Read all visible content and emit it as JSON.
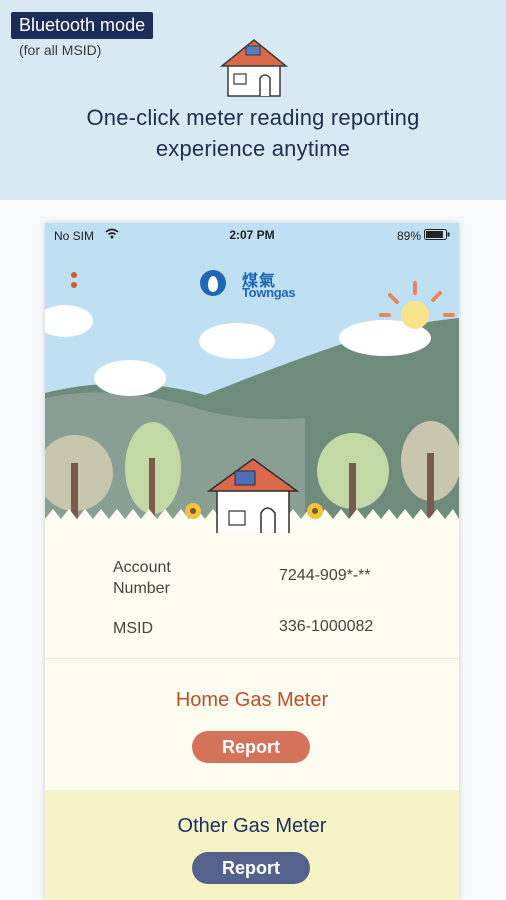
{
  "promo": {
    "badge": "Bluetooth mode",
    "note": "(for all MSID)",
    "headline_line1": "One-click meter reading reporting",
    "headline_line2": "experience anytime"
  },
  "status_bar": {
    "carrier": "No SIM",
    "time": "2:07 PM",
    "battery": "89%",
    "battery_level": 0.89
  },
  "logo": {
    "chinese": "煤氣",
    "english": "Towngas"
  },
  "account": {
    "number_label": "Account Number",
    "number_value": "7244-909*-**",
    "msid_label": "MSID",
    "msid_value": "336-1000082"
  },
  "home_meter": {
    "title": "Home Gas Meter",
    "button": "Report"
  },
  "other_meter": {
    "title": "Other Gas Meter",
    "button": "Report"
  },
  "colors": {
    "brand_blue": "#1f66b3",
    "home_accent": "#c24e26",
    "other_accent": "#1d2f63",
    "badge_bg": "#1c2d5a"
  }
}
